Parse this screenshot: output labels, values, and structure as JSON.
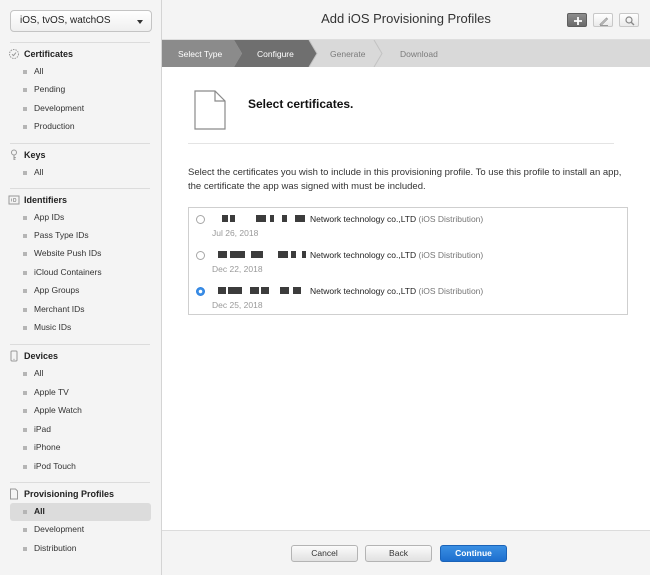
{
  "platform_select": {
    "value": "iOS, tvOS, watchOS"
  },
  "header": {
    "title": "Add iOS Provisioning Profiles"
  },
  "toolbar": {
    "icons": [
      "plus-icon",
      "edit-icon",
      "search-icon"
    ]
  },
  "steps": [
    {
      "label": "Select Type",
      "state": "done"
    },
    {
      "label": "Configure",
      "state": "current"
    },
    {
      "label": "Generate",
      "state": "todo"
    },
    {
      "label": "Download",
      "state": "todo"
    }
  ],
  "sidebar": {
    "sections": [
      {
        "title": "Certificates",
        "icon": "certificate-icon",
        "items": [
          "All",
          "Pending",
          "Development",
          "Production"
        ]
      },
      {
        "title": "Keys",
        "icon": "key-icon",
        "items": [
          "All"
        ]
      },
      {
        "title": "Identifiers",
        "icon": "id-icon",
        "items": [
          "App IDs",
          "Pass Type IDs",
          "Website Push IDs",
          "iCloud Containers",
          "App Groups",
          "Merchant IDs",
          "Music IDs"
        ]
      },
      {
        "title": "Devices",
        "icon": "device-icon",
        "items": [
          "All",
          "Apple TV",
          "Apple Watch",
          "iPad",
          "iPhone",
          "iPod Touch"
        ]
      },
      {
        "title": "Provisioning Profiles",
        "icon": "profile-icon",
        "items": [
          "All",
          "Development",
          "Distribution"
        ],
        "selected": "All"
      }
    ]
  },
  "main": {
    "heading": "Select certificates.",
    "instructions": "Select the certificates you wish to include in this provisioning profile. To use this profile to install an app, the certificate the app was signed with must be included.",
    "certificates": [
      {
        "name": "Network technology co.,LTD",
        "type": "(iOS Distribution)",
        "date": "Jul 26, 2018",
        "selected": false
      },
      {
        "name": "Network technology co.,LTD",
        "type": "(iOS Distribution)",
        "date": "Dec 22, 2018",
        "selected": false
      },
      {
        "name": "Network technology co.,LTD",
        "type": "(iOS Distribution)",
        "date": "Dec 25, 2018",
        "selected": true
      }
    ]
  },
  "footer": {
    "cancel_label": "Cancel",
    "back_label": "Back",
    "continue_label": "Continue"
  },
  "colors": {
    "accent": "#2f82e0",
    "step_done": "#8b8b8b",
    "step_current": "#6f6f6f",
    "step_todo": "#d9d9d9"
  }
}
